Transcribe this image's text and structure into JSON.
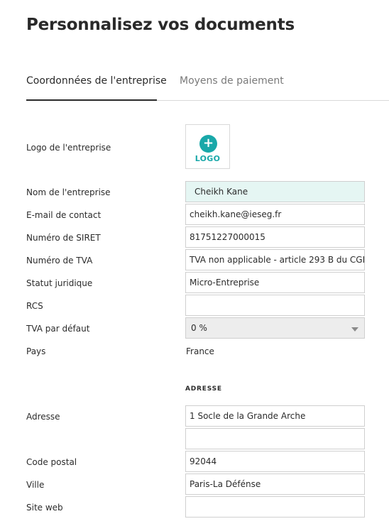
{
  "page": {
    "title": "Personnalisez vos documents"
  },
  "tabs": [
    {
      "label": "Coordonnées de l'entreprise",
      "active": true
    },
    {
      "label": "Moyens de paiement",
      "active": false
    }
  ],
  "colors": {
    "accent": "#19a8a9",
    "highlight_bg": "#e5f6f3",
    "select_bg": "#ededed"
  },
  "company": {
    "logo_label": "Logo de l'entreprise",
    "logo_plus": "+",
    "logo_text": "LOGO",
    "name_label": "Nom de l'entreprise",
    "name_value": "Cheikh Kane",
    "email_label": "E-mail de contact",
    "email_value": "cheikh.kane@ieseg.fr",
    "siret_label": "Numéro de SIRET",
    "siret_value": "81751227000015",
    "tva_number_label": "Numéro de TVA",
    "tva_number_value": "TVA non applicable - article 293 B du CGI",
    "legal_status_label": "Statut juridique",
    "legal_status_value": "Micro-Entreprise",
    "rcs_label": "RCS",
    "rcs_value": "",
    "default_tva_label": "TVA par défaut",
    "default_tva_value": "0 %",
    "country_label": "Pays",
    "country_value": "France"
  },
  "address": {
    "heading": "ADRESSE",
    "address_label": "Adresse",
    "address_line1": "1 Socle de la Grande Arche",
    "address_line2": "",
    "postal_code_label": "Code postal",
    "postal_code_value": "92044",
    "city_label": "Ville",
    "city_value": "Paris-La Défénse",
    "website_label": "Site web",
    "website_value": ""
  }
}
